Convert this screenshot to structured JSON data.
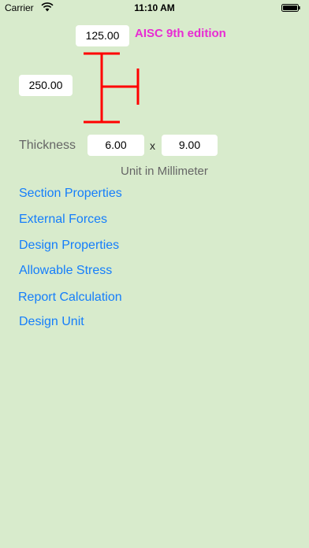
{
  "status_bar": {
    "carrier": "Carrier",
    "time": "11:10 AM",
    "icons": [
      "wifi-icon",
      "battery-icon"
    ]
  },
  "inputs": {
    "flange_width": "125.00",
    "depth": "250.00",
    "web_thickness": "6.00",
    "flange_thickness": "9.00"
  },
  "labels": {
    "edition": "AISC 9th edition",
    "thickness": "Thickness",
    "times": "x",
    "unit": "Unit in Millimeter"
  },
  "menu": [
    {
      "label": "Section Properties"
    },
    {
      "label": "External Forces"
    },
    {
      "label": "Design Properties"
    },
    {
      "label": "Allowable Stress"
    },
    {
      "label": "Report Calculation"
    },
    {
      "label": "Design Unit"
    }
  ],
  "colors": {
    "background": "#d8ebcc",
    "link": "#157efb",
    "edition": "#e82bd3",
    "beam": "#ff0000",
    "label": "#666666"
  }
}
